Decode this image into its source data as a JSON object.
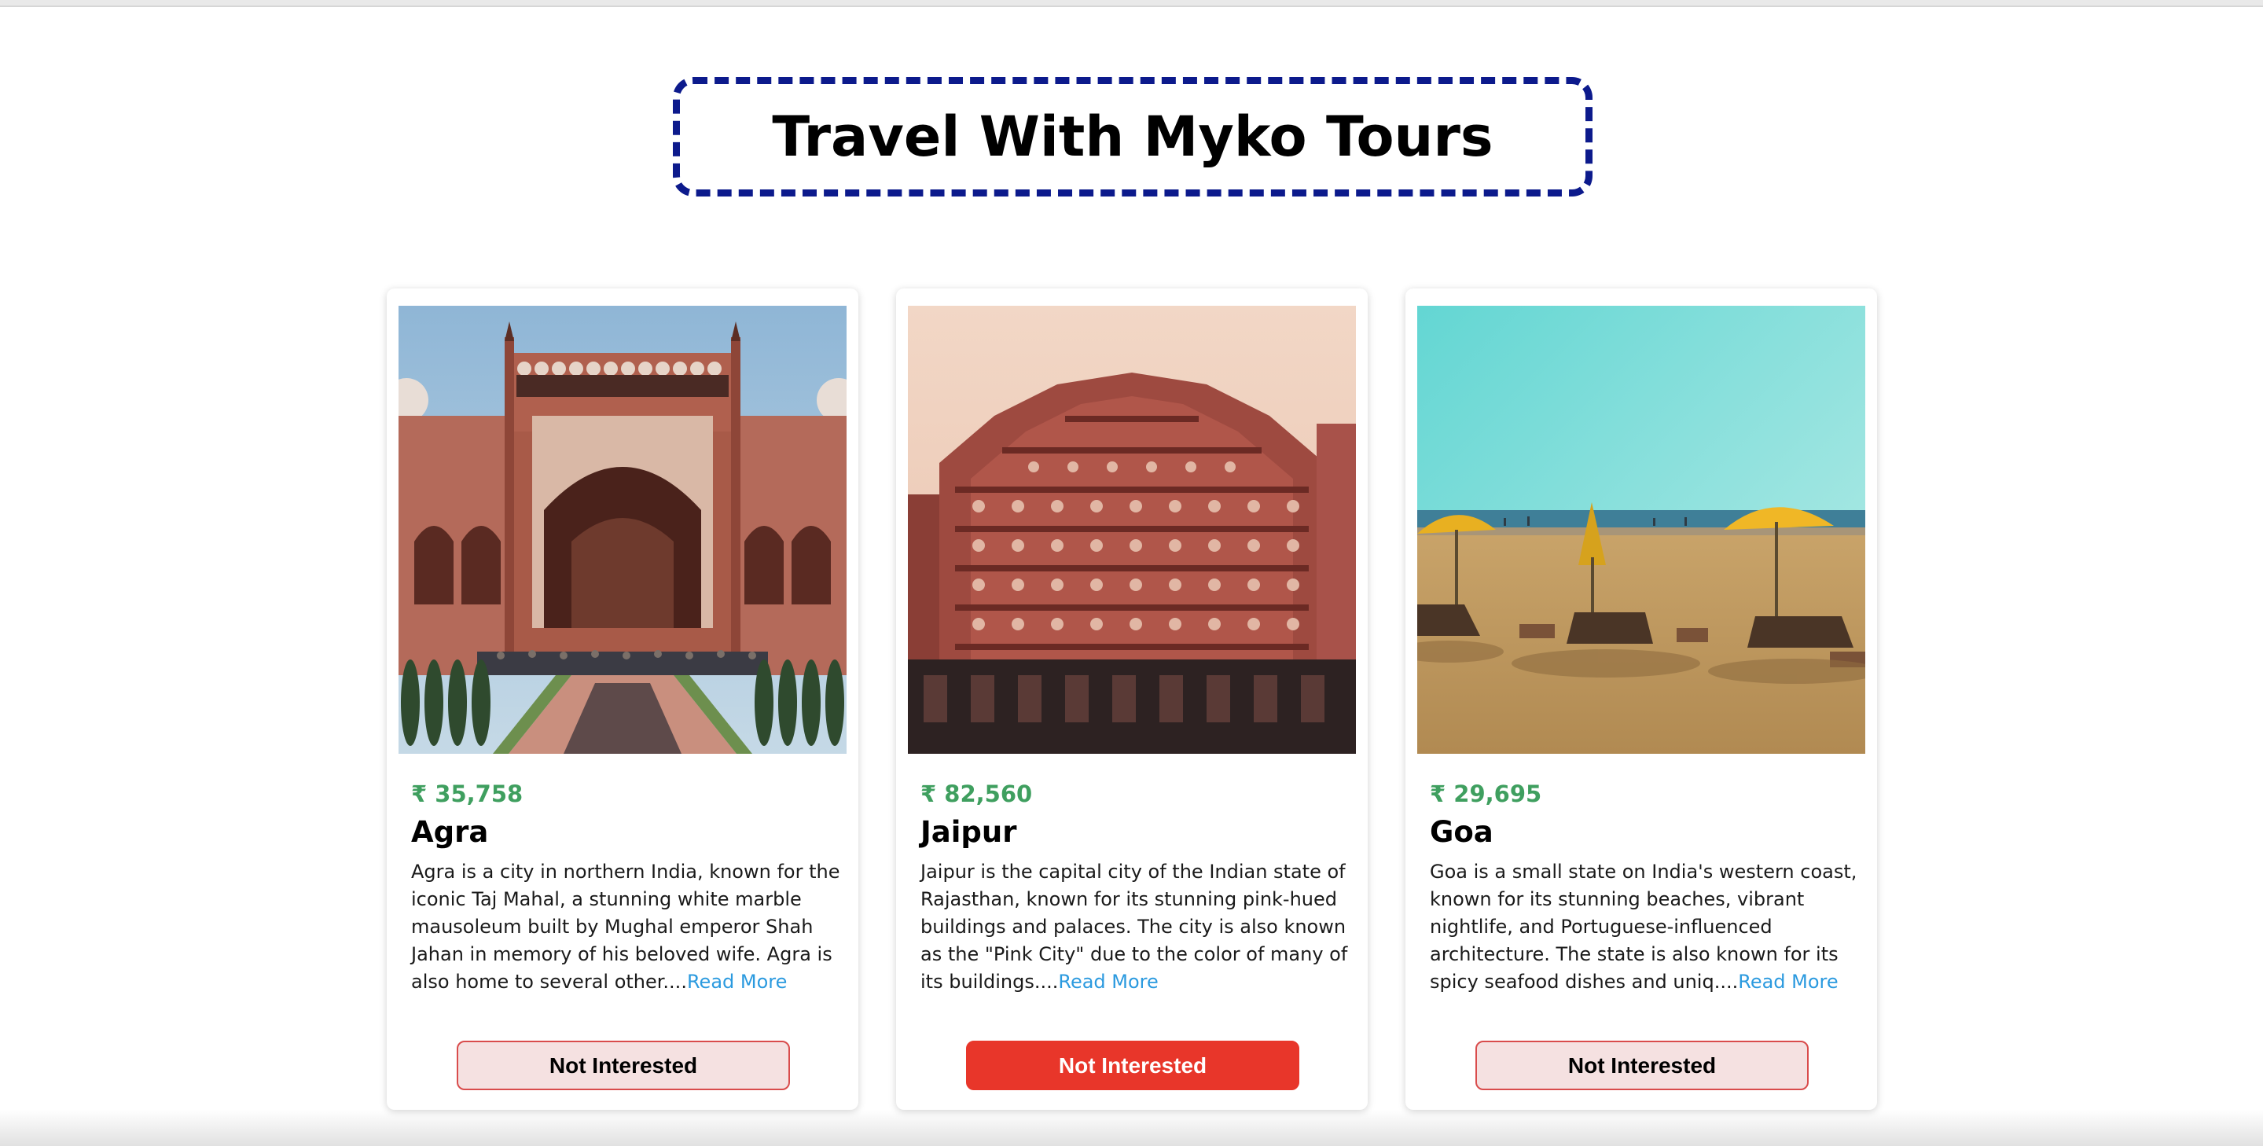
{
  "page": {
    "title": "Travel With Myko Tours"
  },
  "colors": {
    "title_border": "#0c1a8c",
    "price": "#3f9f5f",
    "read_more": "#2b9adf",
    "button_active": "#e8362a",
    "button_inactive": "#f5e1e1"
  },
  "tours": [
    {
      "price": "₹ 35,758",
      "name": "Agra",
      "description": "Agra is a city in northern India, known for the iconic Taj Mahal, a stunning white marble mausoleum built by Mughal emperor Shah Jahan in memory of his beloved wife. Agra is also home to several other....",
      "read_more": "Read More",
      "button": "Not Interested",
      "button_active": false,
      "image": "agra-gateway-photo"
    },
    {
      "price": "₹ 82,560",
      "name": "Jaipur",
      "description": "Jaipur is the capital city of the Indian state of Rajasthan, known for its stunning pink-hued buildings and palaces. The city is also known as the \"Pink City\" due to the color of many of its buildings....",
      "read_more": "Read More",
      "button": "Not Interested",
      "button_active": true,
      "image": "jaipur-hawa-mahal-photo"
    },
    {
      "price": "₹ 29,695",
      "name": "Goa",
      "description": "Goa is a small state on India's western coast, known for its stunning beaches, vibrant nightlife, and Portuguese-influenced architecture. The state is also known for its spicy seafood dishes and uniq....",
      "read_more": "Read More",
      "button": "Not Interested",
      "button_active": false,
      "image": "goa-beach-photo"
    }
  ]
}
